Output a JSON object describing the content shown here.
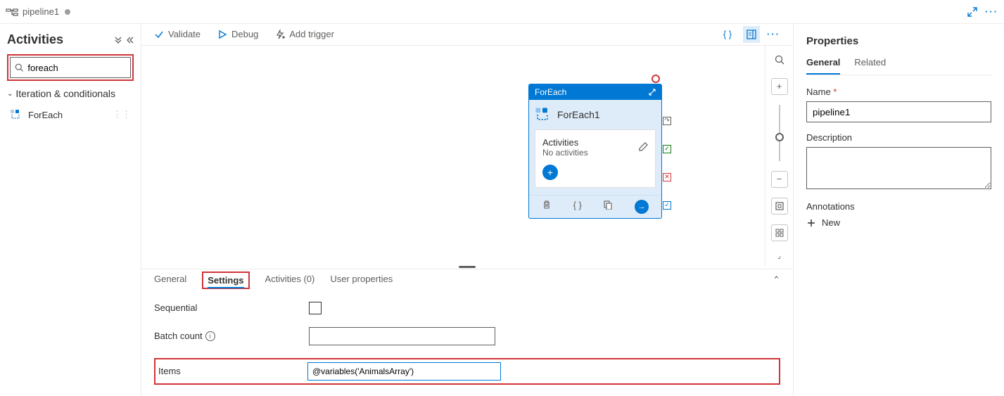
{
  "tab": {
    "title": "pipeline1"
  },
  "leftPanel": {
    "title": "Activities",
    "searchValue": "foreach",
    "category": "Iteration & conditionals",
    "item": "ForEach"
  },
  "toolbar": {
    "validate": "Validate",
    "debug": "Debug",
    "addTrigger": "Add trigger"
  },
  "node": {
    "header": "ForEach",
    "name": "ForEach1",
    "actLabel": "Activities",
    "noAct": "No activities"
  },
  "bottomTabs": {
    "general": "General",
    "settings": "Settings",
    "activities": "Activities (0)",
    "userProps": "User properties"
  },
  "settings": {
    "sequential": "Sequential",
    "batchCount": "Batch count",
    "items": "Items",
    "itemsValue": "@variables('AnimalsArray')"
  },
  "properties": {
    "title": "Properties",
    "generalTab": "General",
    "relatedTab": "Related",
    "nameLabel": "Name",
    "nameValue": "pipeline1",
    "descLabel": "Description",
    "annotationsLabel": "Annotations",
    "newLabel": "New"
  }
}
